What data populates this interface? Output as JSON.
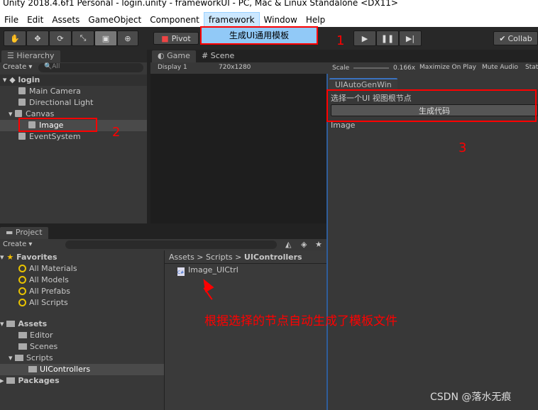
{
  "window_title": "Unity 2018.4.6f1 Personal - login.unity - frameworkUI - PC, Mac & Linux Standalone <DX11>",
  "menu": [
    "File",
    "Edit",
    "Assets",
    "GameObject",
    "Component",
    "framework",
    "Window",
    "Help"
  ],
  "framework_menu_item": "生成UI通用模板",
  "toolbar": {
    "pivot": "Pivot",
    "collab": "Collab"
  },
  "hierarchy": {
    "tab": "Hierarchy",
    "create": "Create",
    "search_placeholder": "All",
    "scene": "login",
    "items": [
      "Main Camera",
      "Directional Light",
      "Canvas",
      "Image",
      "EventSystem"
    ]
  },
  "game": {
    "tab_game": "Game",
    "tab_scene": "Scene",
    "display": "Display 1",
    "resolution": "720x1280",
    "scale_label": "Scale",
    "scale_value": "0.166x",
    "maximize": "Maximize On Play",
    "mute": "Mute Audio",
    "stats": "Stats"
  },
  "uiautogen": {
    "tab": "UIAutoGenWin",
    "prompt": "选择一个UI 视图根节点",
    "button": "生成代码",
    "selected": "Image"
  },
  "project": {
    "tab": "Project",
    "create": "Create",
    "favorites": "Favorites",
    "fav_items": [
      "All Materials",
      "All Models",
      "All Prefabs",
      "All Scripts"
    ],
    "assets": "Assets",
    "asset_items": [
      "Editor",
      "Scenes",
      "Scripts",
      "UIControllers"
    ],
    "packages": "Packages",
    "breadcrumb": [
      "Assets",
      "Scripts",
      "UIControllers"
    ],
    "file": "Image_UICtrl"
  },
  "annotations": {
    "n1": "1",
    "n2": "2",
    "n3": "3",
    "note": "根据选择的节点自动生成了模板文件",
    "watermark": "CSDN @落水无痕"
  }
}
